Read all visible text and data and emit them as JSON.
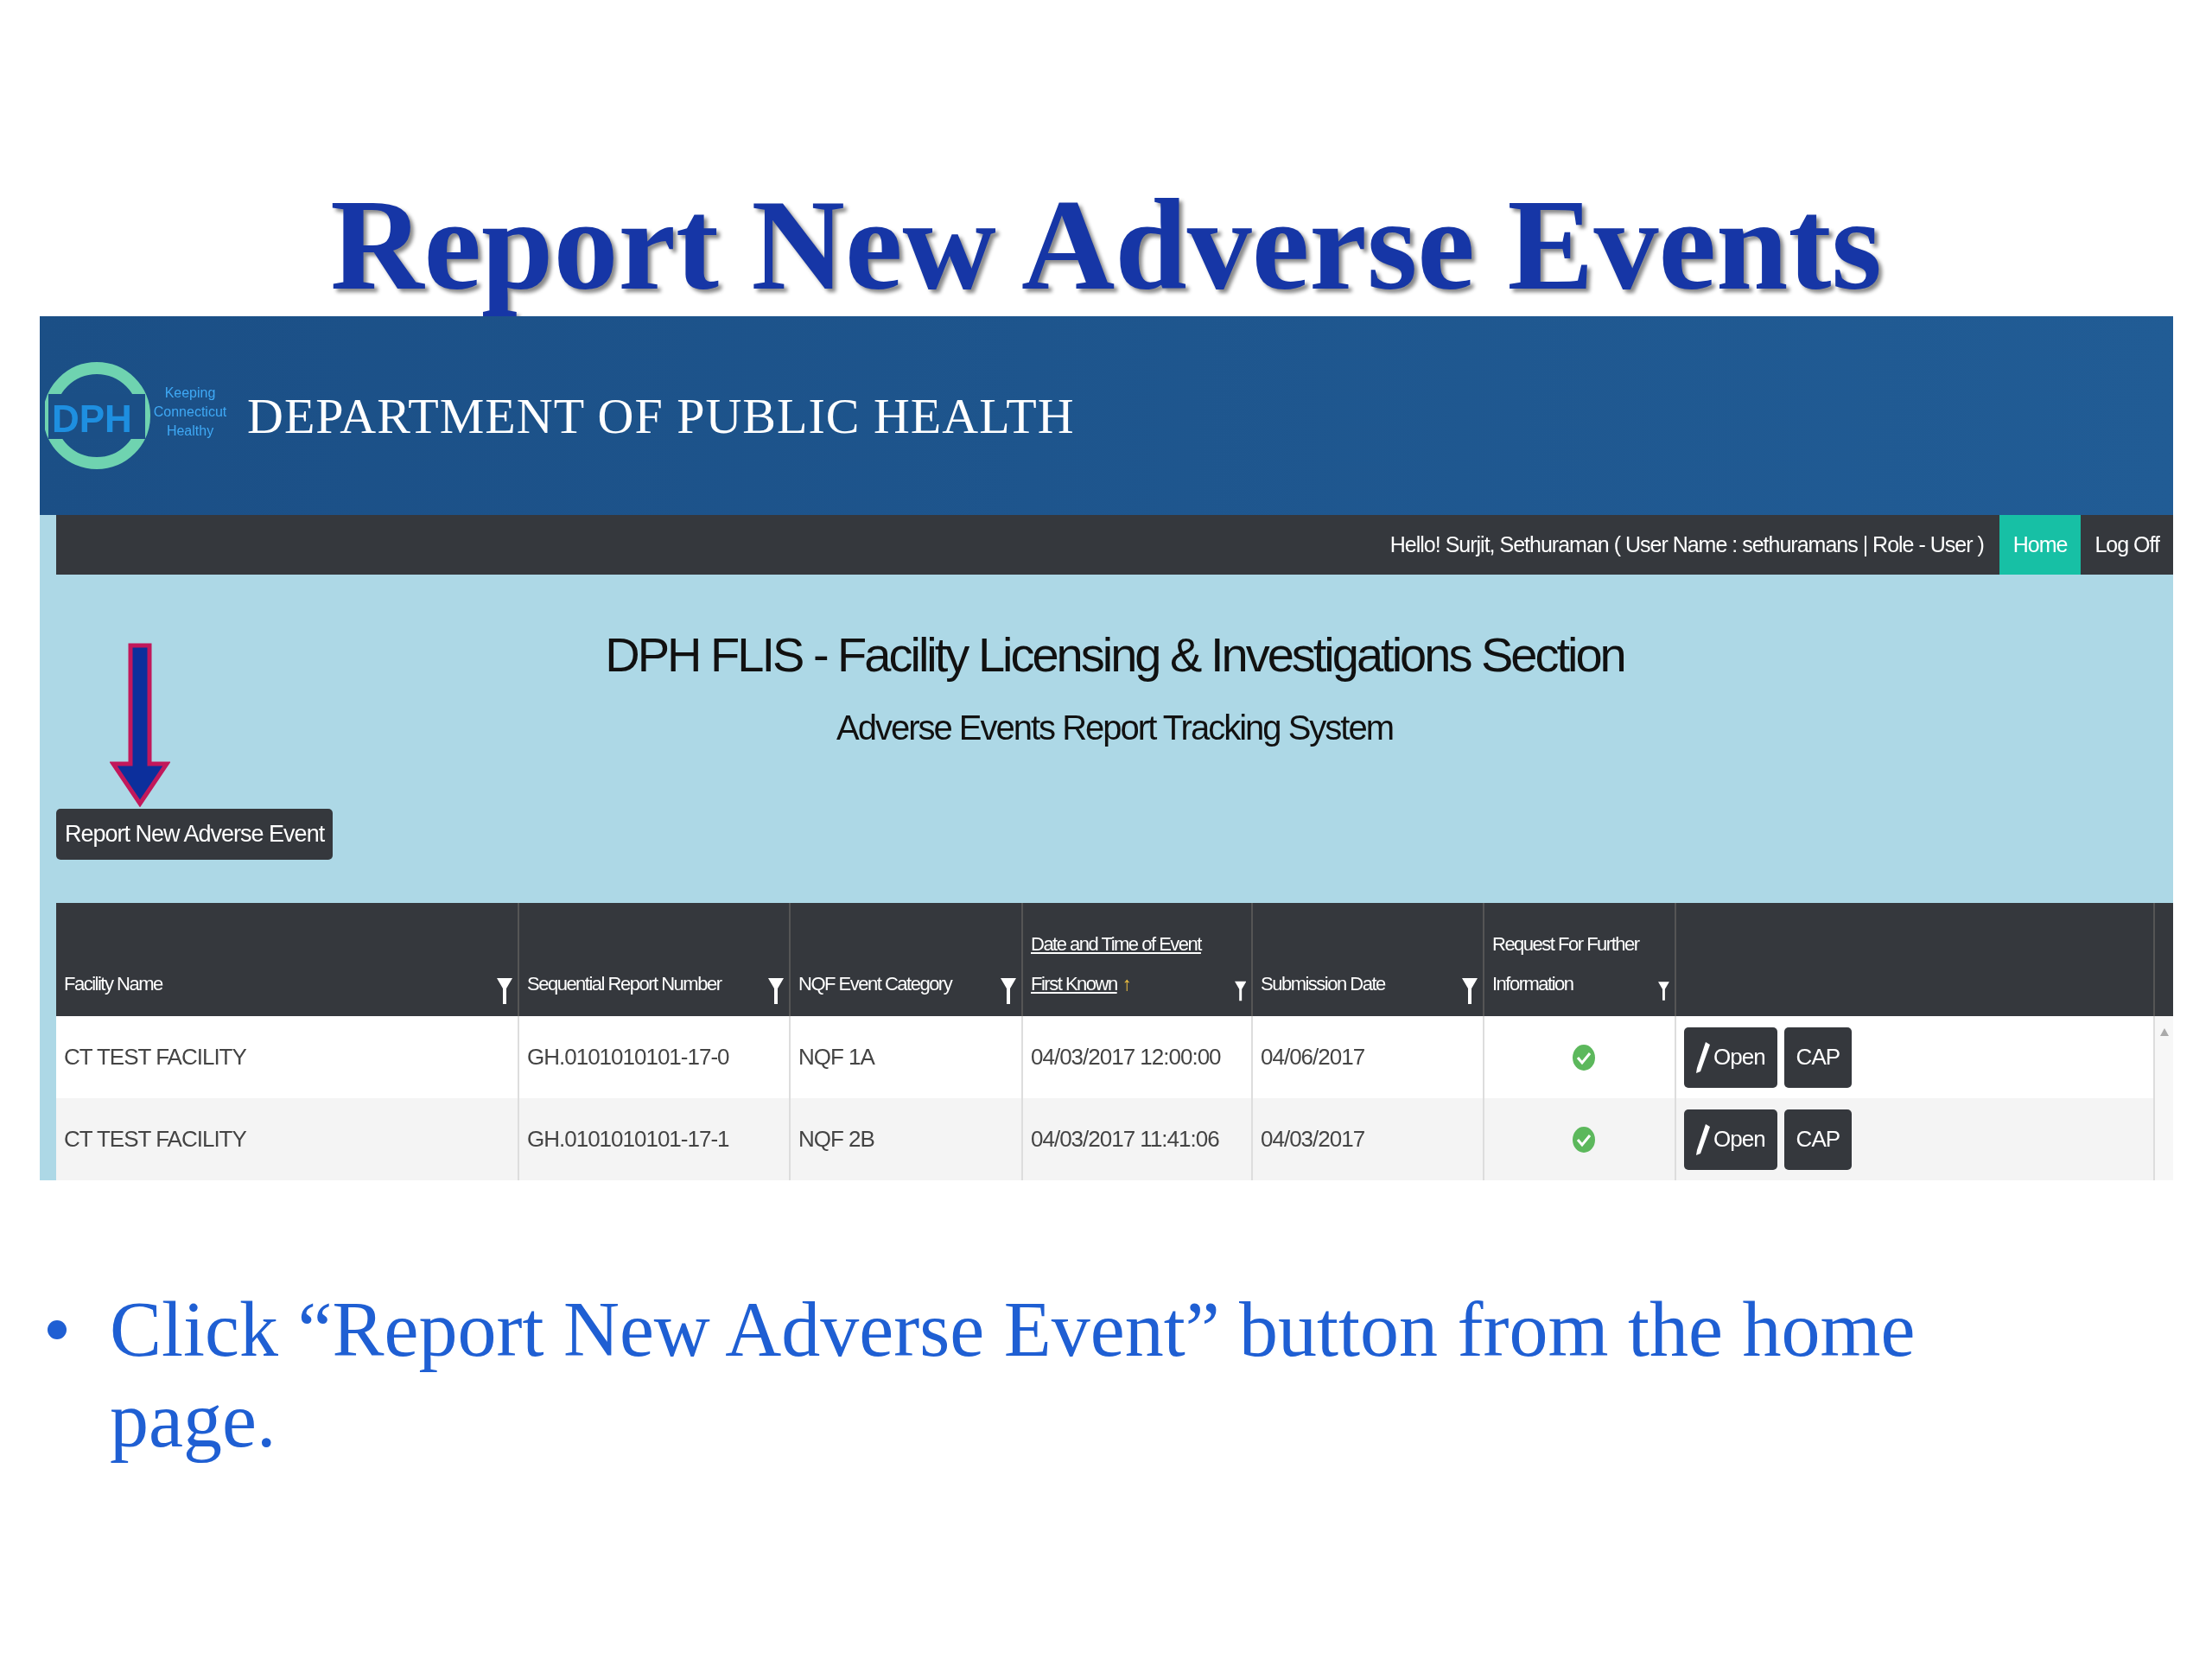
{
  "slide_title": "Report New Adverse Events",
  "app": {
    "logo": {
      "initials": "DPH",
      "tagline": [
        "Keeping",
        "Connecticut",
        "Healthy"
      ]
    },
    "header_title": "DEPARTMENT OF PUBLIC HEALTH",
    "nav": {
      "greeting": "Hello! Surjit, Sethuraman ( User Name : sethuramans | Role - User )",
      "links": [
        {
          "label": "Home",
          "selected": true
        },
        {
          "label": "Log Off",
          "selected": false
        }
      ]
    },
    "heading": "DPH FLIS - Facility Licensing & Investigations Section",
    "subheading": "Adverse Events Report Tracking System",
    "report_button": "Report New Adverse Event",
    "table": {
      "columns": [
        {
          "label": "Facility Name",
          "link": false,
          "filter": true
        },
        {
          "label": "Sequential Report Number",
          "link": false,
          "filter": true
        },
        {
          "label": "NQF Event Category",
          "link": false,
          "filter": true
        },
        {
          "label": "Date and Time of Event First Known",
          "link": true,
          "filter": true,
          "sort_indicator": "↑"
        },
        {
          "label": "Submission Date",
          "link": false,
          "filter": true
        },
        {
          "label": "Request For Further Information",
          "link": false,
          "filter": true
        }
      ],
      "rows": [
        {
          "cells": [
            "CT TEST FACILITY",
            "GH.0101010101-17-0",
            "NQF 1A",
            "04/03/2017 12:00:00",
            "04/06/2017"
          ],
          "request_info": true,
          "actions": [
            "Open",
            "CAP"
          ]
        },
        {
          "cells": [
            "CT TEST FACILITY",
            "GH.0101010101-17-1",
            "NQF 2B",
            "04/03/2017 11:41:06",
            "04/03/2017"
          ],
          "request_info": true,
          "actions": [
            "Open",
            "CAP"
          ]
        }
      ]
    }
  },
  "bullets": [
    "Click “Report New Adverse Event” button from the home page."
  ]
}
